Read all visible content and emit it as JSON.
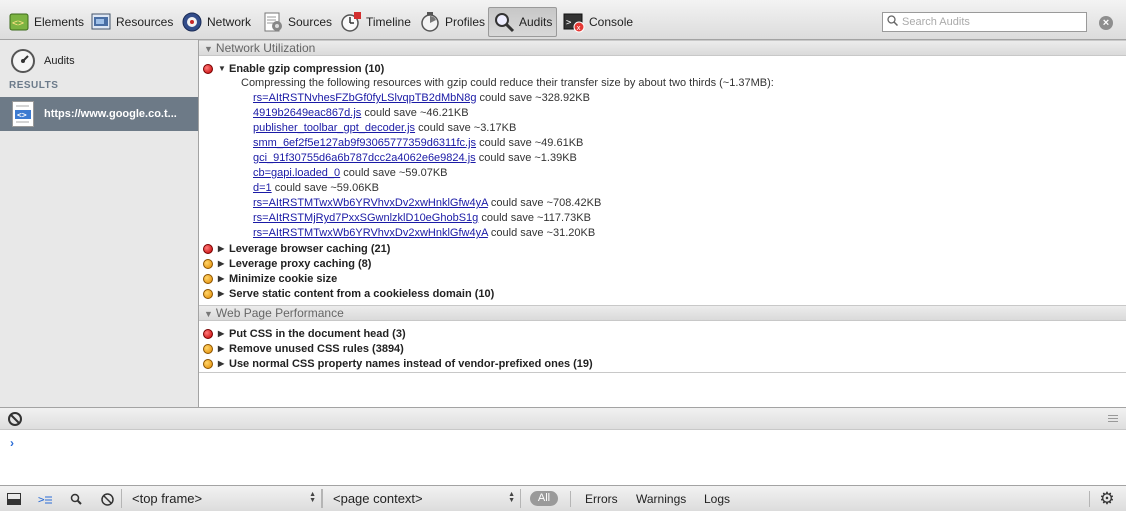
{
  "toolbar": {
    "tabs": [
      {
        "label": "Elements",
        "icon": "elements-icon"
      },
      {
        "label": "Resources",
        "icon": "resources-icon"
      },
      {
        "label": "Network",
        "icon": "network-icon"
      },
      {
        "label": "Sources",
        "icon": "sources-icon"
      },
      {
        "label": "Timeline",
        "icon": "timeline-icon"
      },
      {
        "label": "Profiles",
        "icon": "profiles-icon"
      },
      {
        "label": "Audits",
        "icon": "audits-icon",
        "selected": true
      },
      {
        "label": "Console",
        "icon": "console-icon"
      }
    ],
    "search_placeholder": "Search Audits"
  },
  "sidebar": {
    "audits_label": "Audits",
    "results_heading": "RESULTS",
    "result_item": "https://www.google.co.t..."
  },
  "categories": [
    {
      "title": "Network Utilization",
      "rules": [
        {
          "severity": "red",
          "expanded": true,
          "title": "Enable gzip compression (10)",
          "description": "Compressing the following resources with gzip could reduce their transfer size by about two thirds (~1.37MB):",
          "resources": [
            {
              "link": "rs=AItRSTNvhesFZbGf0fyLSlvqpTB2dMbN8g",
              "saving": "could save ~328.92KB"
            },
            {
              "link": "4919b2649eac867d.js",
              "saving": "could save ~46.21KB"
            },
            {
              "link": "publisher_toolbar_gpt_decoder.js",
              "saving": "could save ~3.17KB"
            },
            {
              "link": "smm_6ef2f5e127ab9f93065777359d6311fc.js",
              "saving": "could save ~49.61KB"
            },
            {
              "link": "gci_91f30755d6a6b787dcc2a4062e6e9824.js",
              "saving": "could save ~1.39KB"
            },
            {
              "link": "cb=gapi.loaded_0",
              "saving": "could save ~59.07KB"
            },
            {
              "link": "d=1",
              "saving": "could save ~59.06KB"
            },
            {
              "link": "rs=AItRSTMTwxWb6YRVhvxDv2xwHnklGfw4yA",
              "saving": "could save ~708.42KB"
            },
            {
              "link": "rs=AItRSTMjRyd7PxxSGwnlzklD10eGhobS1g",
              "saving": "could save ~117.73KB"
            },
            {
              "link": "rs=AItRSTMTwxWb6YRVhvxDv2xwHnklGfw4yA",
              "saving": "could save ~31.20KB"
            }
          ]
        },
        {
          "severity": "red",
          "expanded": false,
          "title": "Leverage browser caching (21)"
        },
        {
          "severity": "orange",
          "expanded": false,
          "title": "Leverage proxy caching (8)"
        },
        {
          "severity": "orange",
          "expanded": false,
          "title": "Minimize cookie size"
        },
        {
          "severity": "orange",
          "expanded": false,
          "title": "Serve static content from a cookieless domain (10)"
        }
      ]
    },
    {
      "title": "Web Page Performance",
      "rules": [
        {
          "severity": "red",
          "expanded": false,
          "title": "Put CSS in the document head (3)"
        },
        {
          "severity": "orange",
          "expanded": false,
          "title": "Remove unused CSS rules (3894)"
        },
        {
          "severity": "orange",
          "expanded": false,
          "title": "Use normal CSS property names instead of vendor-prefixed ones (19)"
        }
      ]
    }
  ],
  "console": {
    "prompt": "›"
  },
  "statusbar": {
    "frame_select": "<top frame>",
    "context_select": "<page context>",
    "filter_all": "All",
    "filters": [
      "Errors",
      "Warnings",
      "Logs"
    ]
  }
}
